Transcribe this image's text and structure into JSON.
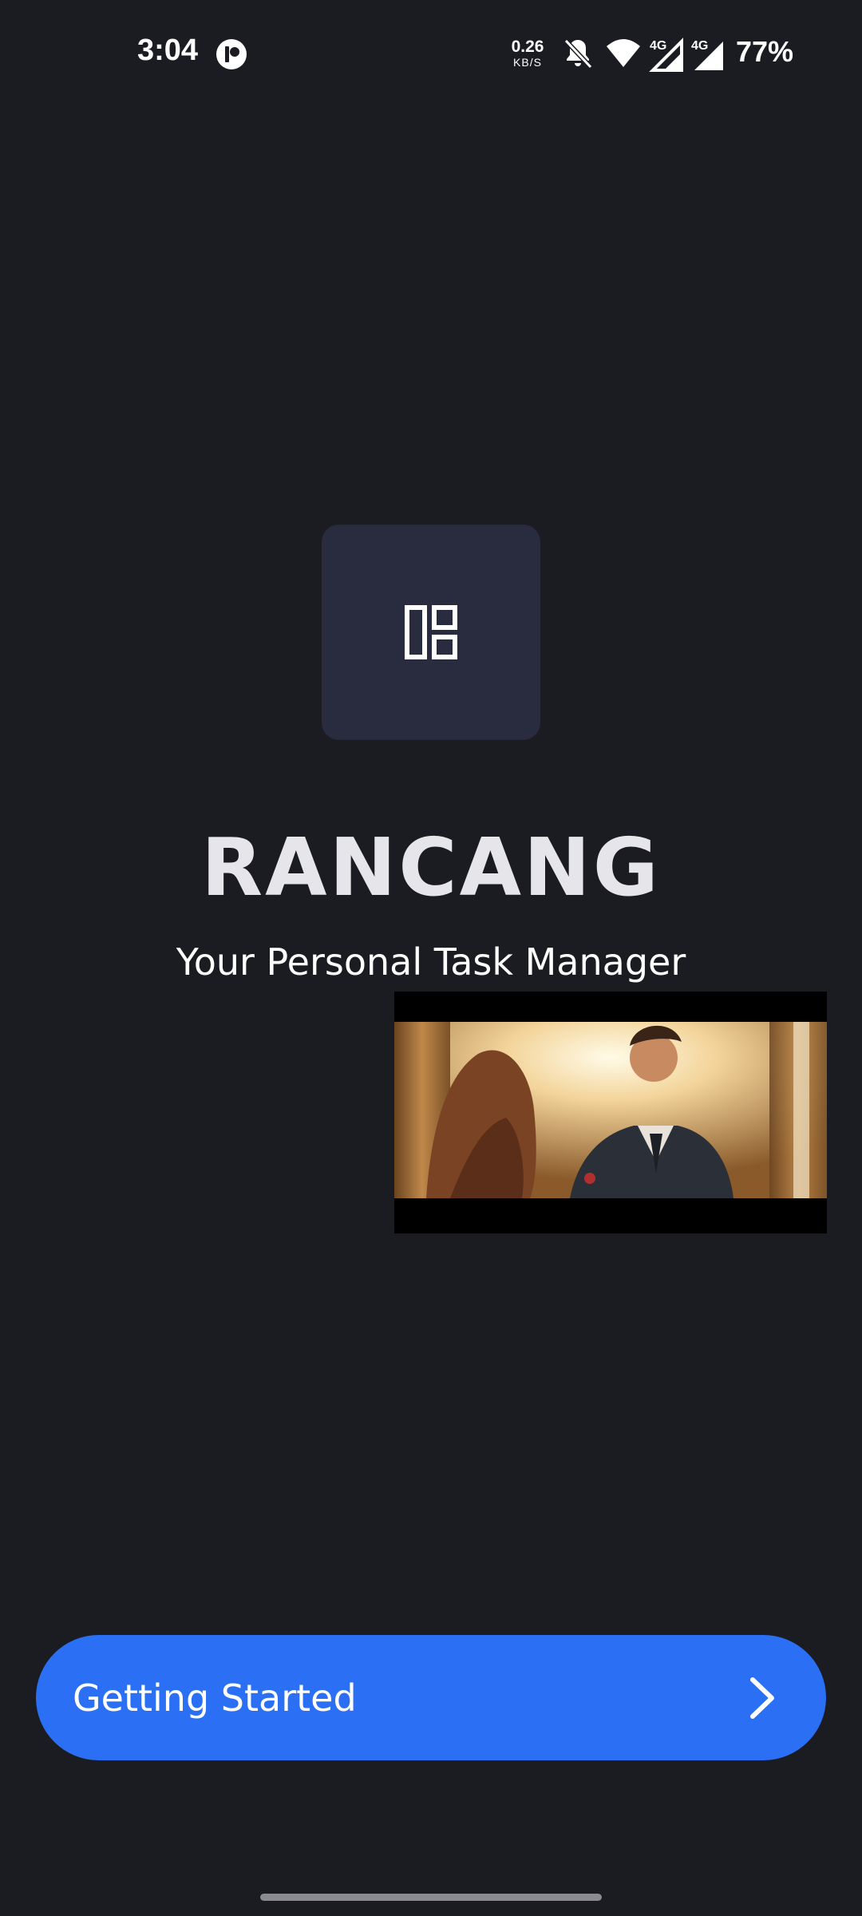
{
  "status_bar": {
    "time": "3:04",
    "net_speed_value": "0.26",
    "net_speed_unit": "KB/S",
    "signal_1_label": "4G",
    "signal_2_label": "4G",
    "battery": "77%",
    "icons": [
      "app-notification-icon",
      "bell-muted-icon",
      "wifi-icon",
      "cell-signal-icon",
      "cell-signal-icon"
    ]
  },
  "app": {
    "logo_icon": "dashboard-layout-icon",
    "title": "RANCANG",
    "subtitle": "Your Personal Task Manager"
  },
  "pip_video": {
    "content": "video-thumbnail"
  },
  "cta": {
    "label": "Getting Started",
    "icon": "chevron-right-icon"
  },
  "colors": {
    "background": "#1b1b22",
    "logo_tile": "#282c3e",
    "button": "#2a6ff4",
    "text": "#ffffff"
  }
}
